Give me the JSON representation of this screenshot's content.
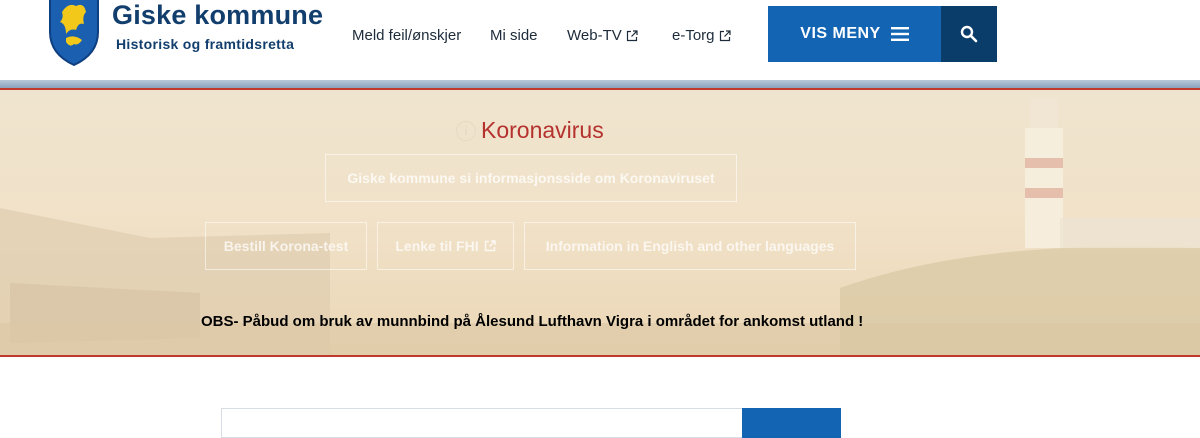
{
  "header": {
    "site_name": "Giske kommune",
    "tagline": "Historisk og framtidsretta",
    "nav": [
      {
        "label": "Meld feil/ønskjer",
        "external": false
      },
      {
        "label": "Mi side",
        "external": false
      },
      {
        "label": "Web-TV",
        "external": true
      },
      {
        "label": "e-Torg",
        "external": true
      }
    ],
    "menu_button_label": "VIS MENY",
    "icons": {
      "menu": "hamburger-icon",
      "search": "search-icon",
      "external": "external-link-icon",
      "crest": "coat-of-arms"
    },
    "colors": {
      "brand": "#123e6e",
      "menu_button": "#1365b4",
      "search_button": "#0b3d6b"
    }
  },
  "alert_banner": {
    "title": "Koronavirus",
    "info_link": "Giske kommune si informasjonsside om Koronaviruset",
    "buttons": [
      {
        "label": "Bestill Korona-test",
        "external": false
      },
      {
        "label": "Lenke til FHI",
        "external": true
      },
      {
        "label": "Information in English and other languages",
        "external": false
      }
    ],
    "notice": "OBS- Påbud om bruk av munnbind på Ålesund Lufthavn Vigra i området for ankomst utland !",
    "colors": {
      "title": "#b5312e",
      "border": "#c0392b"
    }
  },
  "search": {
    "placeholder": ""
  }
}
